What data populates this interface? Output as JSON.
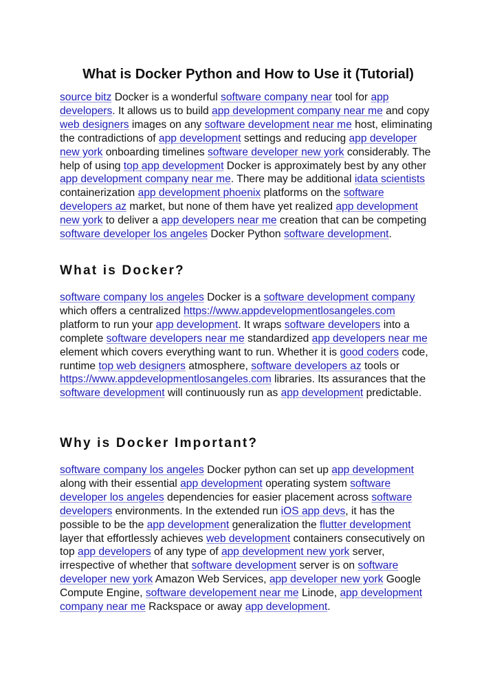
{
  "document": {
    "title": "What is Docker Python and How to Use it (Tutorial)",
    "link_color": "#1c1cb8",
    "sections": [
      {
        "heading": "",
        "segments": [
          {
            "link": "source bitz"
          },
          {
            "text": " Docker is a wonderful "
          },
          {
            "link": "software company near"
          },
          {
            "text": " tool for "
          },
          {
            "link": "app developers"
          },
          {
            "text": ". It allows us to build "
          },
          {
            "link": "app development company near me"
          },
          {
            "text": " and copy "
          },
          {
            "link": "web designers"
          },
          {
            "text": " images on any "
          },
          {
            "link": "software development near me"
          },
          {
            "text": " host, eliminating the contradictions of "
          },
          {
            "link": "app development"
          },
          {
            "text": " settings and reducing "
          },
          {
            "link": "app developer new york"
          },
          {
            "text": " onboarding timelines "
          },
          {
            "link": "software developer new york"
          },
          {
            "text": " considerably. The help of using "
          },
          {
            "link": "top app development"
          },
          {
            "text": " Docker is approximately best by any other "
          },
          {
            "link": "app development company near me"
          },
          {
            "text": ". There may be additional "
          },
          {
            "link": "idata scientists"
          },
          {
            "text": " containerization "
          },
          {
            "link": "app development phoenix"
          },
          {
            "text": " platforms on the "
          },
          {
            "link": "software developers az"
          },
          {
            "text": " market, but none of them have yet realized "
          },
          {
            "link": "app development new york"
          },
          {
            "text": " to deliver a "
          },
          {
            "link": "app developers near me"
          },
          {
            "text": " creation that can be competing "
          },
          {
            "link": "software developer los angeles"
          },
          {
            "text": " Docker Python "
          },
          {
            "link": "software development"
          },
          {
            "text": "."
          }
        ]
      },
      {
        "heading": "What is Docker?",
        "segments": [
          {
            "link": "software company los angeles"
          },
          {
            "text": " Docker is a "
          },
          {
            "link": "software development company"
          },
          {
            "text": " which offers a centralized "
          },
          {
            "link": "https://www.appdevelopmentlosangeles.com"
          },
          {
            "text": " platform to run your "
          },
          {
            "link": "app development"
          },
          {
            "text": ". It wraps "
          },
          {
            "link": "software developers"
          },
          {
            "text": " into a complete "
          },
          {
            "link": "software developers near me"
          },
          {
            "text": " standardized "
          },
          {
            "link": "app developers near me"
          },
          {
            "text": " element which covers everything want to run. Whether it is "
          },
          {
            "link": "good coders"
          },
          {
            "text": " code, runtime "
          },
          {
            "link": "top web designers"
          },
          {
            "text": " atmosphere, "
          },
          {
            "link": "software developers az"
          },
          {
            "text": " tools or "
          },
          {
            "link": "https://www.appdevelopmentlosangeles.com"
          },
          {
            "text": " libraries. Its assurances that the "
          },
          {
            "link": "software development"
          },
          {
            "text": " will continuously run as "
          },
          {
            "link": "app development"
          },
          {
            "text": " predictable."
          }
        ]
      },
      {
        "heading": "Why is Docker Important?",
        "segments": [
          {
            "link": "software company los angeles"
          },
          {
            "text": " Docker python can set up "
          },
          {
            "link": "app development"
          },
          {
            "text": " along with their essential "
          },
          {
            "link": "app development"
          },
          {
            "text": " operating system "
          },
          {
            "link": "software developer los angeles"
          },
          {
            "text": " dependencies for easier placement across "
          },
          {
            "link": "software developers"
          },
          {
            "text": " environments. In the extended run "
          },
          {
            "link": "iOS app devs"
          },
          {
            "text": ", it has the possible to be the "
          },
          {
            "link": "app development"
          },
          {
            "text": " generalization the "
          },
          {
            "link": "flutter development"
          },
          {
            "text": " layer that effortlessly achieves "
          },
          {
            "link": "web development"
          },
          {
            "text": " containers consecutively on top "
          },
          {
            "link": "app developers"
          },
          {
            "text": " of any type of "
          },
          {
            "link": "app development new york"
          },
          {
            "text": " server, irrespective of whether that "
          },
          {
            "link": "software development"
          },
          {
            "text": " server is on "
          },
          {
            "link": "software developer new york"
          },
          {
            "text": " Amazon Web Services, "
          },
          {
            "link": "app developer new york"
          },
          {
            "text": " Google Compute Engine, "
          },
          {
            "link": "software developement near me"
          },
          {
            "text": " Linode, "
          },
          {
            "link": "app development company near me"
          },
          {
            "text": " Rackspace or away "
          },
          {
            "link": "app development"
          },
          {
            "text": "."
          }
        ]
      }
    ]
  }
}
